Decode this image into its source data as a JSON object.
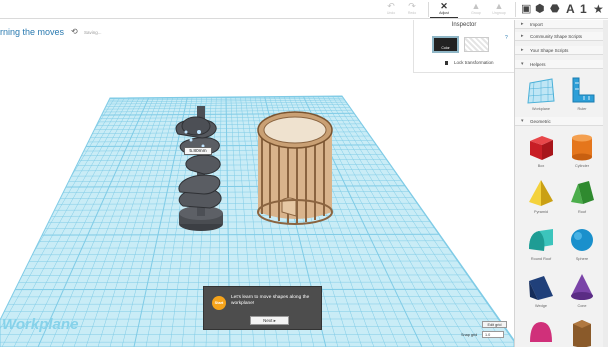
{
  "toolbar": {
    "undo": "Undo",
    "redo": "Redo",
    "adjust": "Adjust",
    "group": "Group",
    "ungroup": "Ungroup",
    "view_letter": "A",
    "view_number": "1"
  },
  "header": {
    "title": "rning the moves",
    "status": "Saving..."
  },
  "inspector": {
    "title": "Inspector",
    "color_label": "Color",
    "help": "?",
    "lock_label": "Lock transformation"
  },
  "sidebar": {
    "sections": [
      {
        "label": "Import",
        "expanded": false
      },
      {
        "label": "Community Shape Scripts",
        "expanded": false
      },
      {
        "label": "Your Shape Scripts",
        "expanded": false
      },
      {
        "label": "Helpers",
        "expanded": true
      },
      {
        "label": "Geometric",
        "expanded": true
      }
    ],
    "helpers": [
      {
        "label": "Workplane",
        "icon": "workplane-icon"
      },
      {
        "label": "Ruler",
        "icon": "ruler-icon"
      }
    ],
    "shapes": [
      {
        "label": "Box",
        "icon": "box-icon",
        "color": "#d3262b"
      },
      {
        "label": "Cylinder",
        "icon": "cylinder-icon",
        "color": "#e5761c"
      },
      {
        "label": "Pyramid",
        "icon": "pyramid-icon",
        "color": "#f0c42a"
      },
      {
        "label": "Roof",
        "icon": "roof-icon",
        "color": "#3c9a3c"
      },
      {
        "label": "Round Roof",
        "icon": "round-roof-icon",
        "color": "#2ab0a8"
      },
      {
        "label": "Sphere",
        "icon": "sphere-icon",
        "color": "#1a90cc"
      },
      {
        "label": "Wedge",
        "icon": "wedge-icon",
        "color": "#20407a"
      },
      {
        "label": "Cone",
        "icon": "cone-icon",
        "color": "#6a3898"
      },
      {
        "label": "",
        "icon": "paraboloid-icon",
        "color": "#d0307a"
      },
      {
        "label": "",
        "icon": "hexagonal-prism-icon",
        "color": "#8a5a2a"
      }
    ]
  },
  "workplane": {
    "label": "Workplane",
    "dimension": "5.80mm",
    "edit_grid": "Edit grid",
    "snap_label": "Snap grid",
    "snap_value": "1.0"
  },
  "tutorial": {
    "badge": "Start",
    "message": "Let's learn to move shapes along the workplane!",
    "next": "Next ▸"
  },
  "colors": {
    "accent": "#2a7ab0",
    "grid": "#7fcbe6",
    "workplane_fill": "#c9ecf6",
    "tutorial_badge": "#f5a31a"
  }
}
